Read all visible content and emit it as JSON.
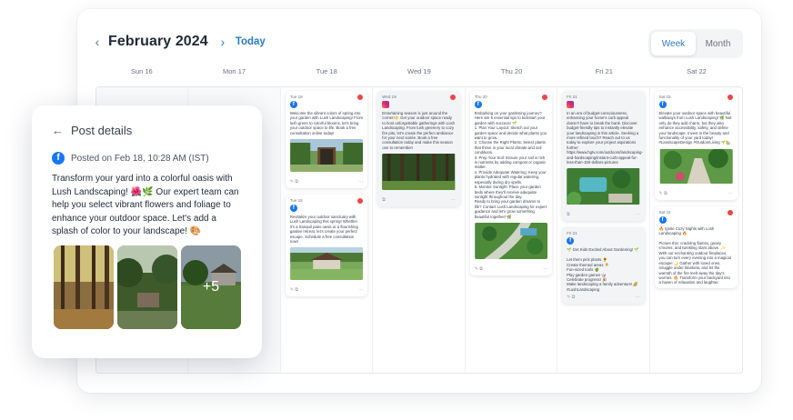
{
  "calendar": {
    "month_label": "February 2024",
    "today_label": "Today",
    "views": [
      "Week",
      "Month"
    ],
    "active_view": "Week",
    "days": [
      "Sun 16",
      "Mon 17",
      "Tue 18",
      "Wed 19",
      "Thu 20",
      "Fri 21",
      "Sat 22"
    ]
  },
  "posts": {
    "tue_1": {
      "date": "Tue 18",
      "text": "Welcome the vibrant colors of spring into your garden with Lush Landscaping! From lush green to colorful blooms, let's bring your outdoor space to life. Book a free consultation online today!"
    },
    "tue_2": {
      "date": "Tue 18",
      "text": "Revitalize your outdoor sanctuary with Lush Landscaping this spring! Whether it's a tranquil patio oasis or a flourishing garden retreat, let's create your perfect escape. Schedule a free consultation now!"
    },
    "wed_1": {
      "date": "Wed 19",
      "text": "Entertaining season is just around the corner!☀️ Get your outdoor space ready to host unforgettable gatherings with Lush Landscaping. From lush greenery to cozy fire pits, let's create the perfect ambiance for your next soirée. Book a free consultation today and make this season one to remember!"
    },
    "thu_1": {
      "date": "Thu 20",
      "text": "Embarking on your gardening journey? Here are 5 essential tips to kickstart your garden with success! 🌱\n1. Plan Your Layout: Sketch out your garden space and decide what plants you want to grow.\n2. Choose the Right Plants: Select plants that thrive in your local climate and soil conditions.\n3. Prep Your Soil: Ensure your soil is rich in nutrients by adding compost or organic matter.\n4. Provide Adequate Watering: Keep your plants hydrated with regular watering, especially during dry spells.\n5. Monitor Sunlight: Place your garden beds where they'll receive adequate sunlight throughout the day.\nReady to bring your garden dreams to life? Contact Lush Landscaping for expert guidance and let's grow something beautiful together! 🌿"
    },
    "fri_1": {
      "date": "Fri 21",
      "text": "In an era of budget-consciousness, enhancing your home's curb appeal doesn't have to break the bank. Discover budget-friendly tips to instantly elevate your landscaping in this article. Seeking a more refined touch? Reach out to us today to explore your project aspirations further: https://www.hgtv.com/outdoors/landscaping-and-hardscaping/instant-curb-appeal-for-less-than-150-dollars-pictures"
    },
    "fri_2": {
      "date": "Fri 21",
      "text": "🌱 Get Kids Excited About Gardening! 🌱\n\nLet them pick plants 🌻\nCreate themed areas 🧚\nFun-sized tools 🪴\nPlay garden games 🎲\nCelebrate progress! 🎉\nMake landscaping a family adventure! 🌈 #LushLandscaping"
    },
    "sat_1": {
      "date": "Sat 22",
      "text": "Elevate your outdoor space with beautiful walkways from Lush Landscaping! 🌿 Not only do they add charm, but they also enhance accessibility, safety, and define your landscape. Invest in the beauty and functionality of your yard today! #LandscapeDesign #OutdoorLiving 🌱🏡"
    },
    "sat_2": {
      "date": "Sat 22",
      "text": "🔥 Ignite Cozy Nights with Lush Landscaping 🔥\n\nPicture this: crackling flames, gooey s'mores, and twinkling stars above. ✨ With our enchanting outdoor fireplaces, you can turn every evening into a magical escape! 🌙 Gather with loved ones, snuggle under blankets, and let the warmth of the fire melt away the day's worries. 🔥 Transform your backyard into a haven of relaxation and laughter."
    }
  },
  "details": {
    "title": "Post details",
    "posted_on": "Posted on Feb 18, 10:28 AM (IST)",
    "text": "Transform your yard into a colorful oasis with Lush Landscaping! 🌺🌿 Our expert team can help you select vibrant flowers and foliage to enhance your outdoor space. Let's add a splash of color to your landscape! 🎨",
    "more_photos": "+5"
  },
  "colors": {
    "accent": "#2b7bbf",
    "facebook": "#1877f2",
    "status_dot": "#ef4444"
  }
}
